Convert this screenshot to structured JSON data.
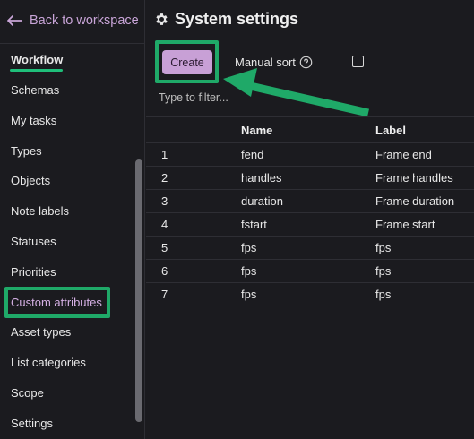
{
  "sidebar": {
    "back_label": "Back to workspace",
    "items": [
      {
        "label": "Workflow"
      },
      {
        "label": "Schemas"
      },
      {
        "label": "My tasks"
      },
      {
        "label": "Types"
      },
      {
        "label": "Objects"
      },
      {
        "label": "Note labels"
      },
      {
        "label": "Statuses"
      },
      {
        "label": "Priorities"
      },
      {
        "label": "Custom attributes"
      },
      {
        "label": "Asset types"
      },
      {
        "label": "List categories"
      },
      {
        "label": "Scope"
      },
      {
        "label": "Settings"
      }
    ]
  },
  "main": {
    "title": "System settings",
    "create_label": "Create",
    "manual_sort_label": "Manual sort",
    "manual_sort_checked": false,
    "filter_placeholder": "Type to filter...",
    "table": {
      "headers": [
        "",
        "Name",
        "Label"
      ],
      "rows": [
        {
          "num": "1",
          "name": "fend",
          "label": "Frame end"
        },
        {
          "num": "2",
          "name": "handles",
          "label": "Frame handles"
        },
        {
          "num": "3",
          "name": "duration",
          "label": "Frame duration"
        },
        {
          "num": "4",
          "name": "fstart",
          "label": "Frame start"
        },
        {
          "num": "5",
          "name": "fps",
          "label": "fps"
        },
        {
          "num": "6",
          "name": "fps",
          "label": "fps"
        },
        {
          "num": "7",
          "name": "fps",
          "label": "fps"
        }
      ]
    }
  },
  "colors": {
    "accent": "#c8a0d6",
    "highlight": "#1fa968",
    "background": "#1b1b1f"
  },
  "icons": {
    "back": "arrow-left-icon",
    "title": "gear-icon",
    "help": "question-circle-icon"
  }
}
